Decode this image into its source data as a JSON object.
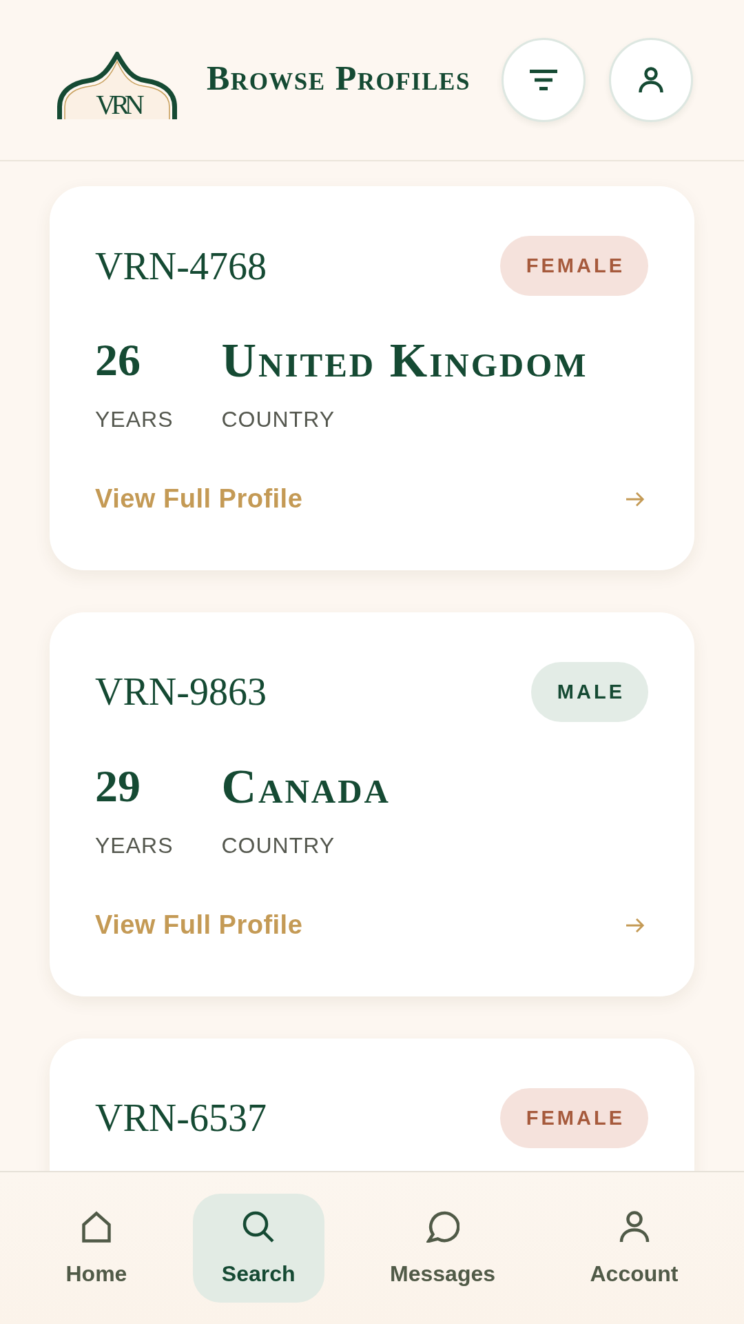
{
  "header": {
    "logo_text": "VRN",
    "title": "Browse Profiles"
  },
  "profiles": [
    {
      "id": "VRN-4768",
      "badge": {
        "label": "FEMALE",
        "kind": "female"
      },
      "age": "26",
      "age_label": "YEARS",
      "country": "United Kingdom",
      "country_label": "COUNTRY",
      "link": "View Full Profile"
    },
    {
      "id": "VRN-9863",
      "badge": {
        "label": "MALE",
        "kind": "male"
      },
      "age": "29",
      "age_label": "YEARS",
      "country": "Canada",
      "country_label": "COUNTRY",
      "link": "View Full Profile"
    },
    {
      "id": "VRN-6537",
      "badge": {
        "label": "FEMALE",
        "kind": "female"
      }
    }
  ],
  "nav": [
    {
      "label": "Home",
      "selected": false
    },
    {
      "label": "Search",
      "selected": true
    },
    {
      "label": "Messages",
      "selected": false
    },
    {
      "label": "Account",
      "selected": false
    }
  ]
}
